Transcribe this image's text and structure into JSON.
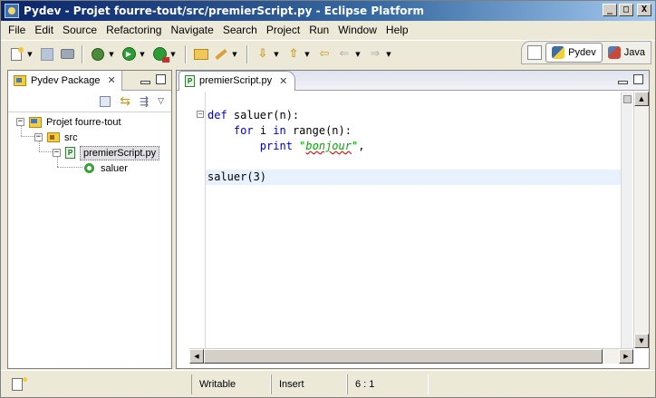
{
  "window": {
    "title": "Pydev - Projet fourre-tout/src/premierScript.py - Eclipse Platform",
    "controls": {
      "minimize": "_",
      "maximize": "□",
      "close": "X"
    }
  },
  "menu": [
    "File",
    "Edit",
    "Source",
    "Refactoring",
    "Navigate",
    "Search",
    "Project",
    "Run",
    "Window",
    "Help"
  ],
  "perspectives": {
    "open_icon": "open-perspective-icon",
    "items": [
      {
        "label": "Pydev",
        "icon": "python-icon",
        "active": true
      },
      {
        "label": "Java",
        "icon": "java-icon",
        "active": false
      }
    ]
  },
  "package_view": {
    "tab_label": "Pydev Package",
    "tree": {
      "project": "Projet fourre-tout",
      "source_folder": "src",
      "file": "premierScript.py",
      "function": "saluer"
    }
  },
  "editor": {
    "tab_label": "premierScript.py",
    "code": {
      "line1": {
        "kw": "def",
        "rest": " saluer(n):"
      },
      "line2": {
        "indent": "    ",
        "kw1": "for",
        "mid": " i ",
        "kw2": "in",
        "rest": " range(n):"
      },
      "line3": {
        "indent": "        ",
        "kw": "print",
        "space": " ",
        "str_open": "\"",
        "str_word": "bonjour",
        "str_close": "\"",
        "rest": ","
      },
      "line5": {
        "text": "saluer(3)"
      }
    }
  },
  "status": {
    "writable": "Writable",
    "insert_mode": "Insert",
    "position": "6 : 1"
  },
  "colors": {
    "keyword": "#0000c8",
    "string": "#00aa00",
    "current_line": "#e8f2fe"
  }
}
